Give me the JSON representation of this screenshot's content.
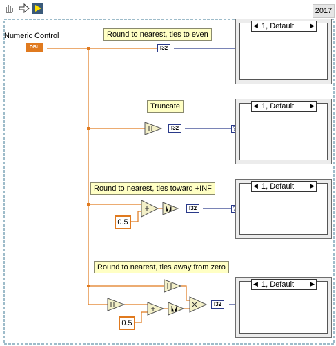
{
  "toolbar": {
    "icons": [
      "hand-tool-icon",
      "arrow-tool-icon",
      "run-arrow-icon"
    ],
    "version": "2017"
  },
  "control": {
    "label": "Numeric Control",
    "type_text": "DBL"
  },
  "notes": {
    "even": "Round to nearest, ties to even",
    "trunc": "Truncate",
    "inf": "Round  to nearest, ties toward +INF",
    "away": "Round to nearest, ties away from zero"
  },
  "constants": {
    "inf_half": "0.5",
    "away_half": "0.5"
  },
  "tags": {
    "i32": "I32",
    "question": "?"
  },
  "indicators": {
    "value": "1, Default",
    "left_arrow": "◀",
    "right_arrow": "▶"
  },
  "colors": {
    "numeric_wire": "#e07a1f",
    "int_wire": "#2a3a8a",
    "note_bg": "#ffffc4"
  }
}
